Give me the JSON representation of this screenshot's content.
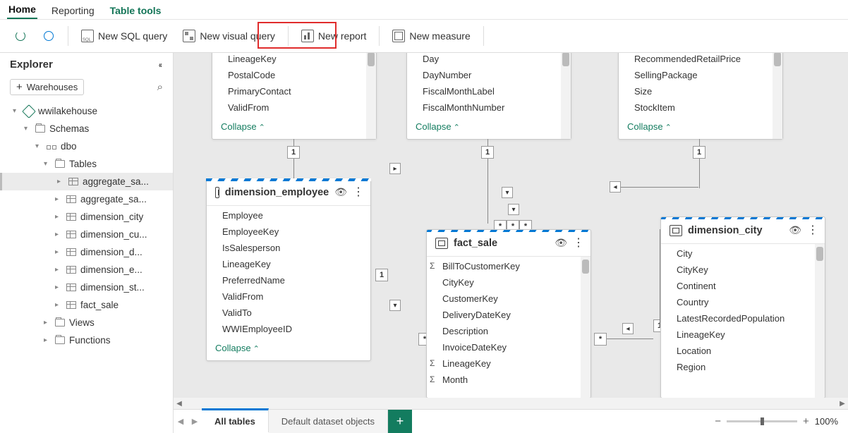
{
  "tabs": {
    "home": "Home",
    "reporting": "Reporting",
    "table_tools": "Table tools"
  },
  "ribbon": {
    "new_sql": "New SQL query",
    "new_visual": "New visual query",
    "new_report": "New report",
    "new_measure": "New measure"
  },
  "explorer": {
    "title": "Explorer",
    "warehouses_btn": "Warehouses",
    "tree": {
      "root": "wwilakehouse",
      "schemas": "Schemas",
      "dbo": "dbo",
      "tables_label": "Tables",
      "tables": [
        "aggregate_sa...",
        "aggregate_sa...",
        "dimension_city",
        "dimension_cu...",
        "dimension_d...",
        "dimension_e...",
        "dimension_st...",
        "fact_sale"
      ],
      "views": "Views",
      "functions": "Functions"
    }
  },
  "cards": {
    "collapse": "Collapse",
    "top1": {
      "fields": [
        "LineageKey",
        "PostalCode",
        "PrimaryContact",
        "ValidFrom"
      ]
    },
    "top2": {
      "fields": [
        "Day",
        "DayNumber",
        "FiscalMonthLabel",
        "FiscalMonthNumber"
      ]
    },
    "top3": {
      "fields": [
        "RecommendedRetailPrice",
        "SellingPackage",
        "Size",
        "StockItem"
      ]
    },
    "emp": {
      "title": "dimension_employee",
      "fields": [
        "Employee",
        "EmployeeKey",
        "IsSalesperson",
        "LineageKey",
        "PreferredName",
        "ValidFrom",
        "ValidTo",
        "WWIEmployeeID"
      ]
    },
    "fact": {
      "title": "fact_sale",
      "fields": [
        "BillToCustomerKey",
        "CityKey",
        "CustomerKey",
        "DeliveryDateKey",
        "Description",
        "InvoiceDateKey",
        "LineageKey",
        "Month"
      ]
    },
    "city": {
      "title": "dimension_city",
      "fields": [
        "City",
        "CityKey",
        "Continent",
        "Country",
        "LatestRecordedPopulation",
        "LineageKey",
        "Location",
        "Region"
      ]
    }
  },
  "rel": {
    "one": "1",
    "many": "*"
  },
  "footer": {
    "all_tables": "All tables",
    "default_dataset": "Default dataset objects",
    "zoom": "100%"
  }
}
